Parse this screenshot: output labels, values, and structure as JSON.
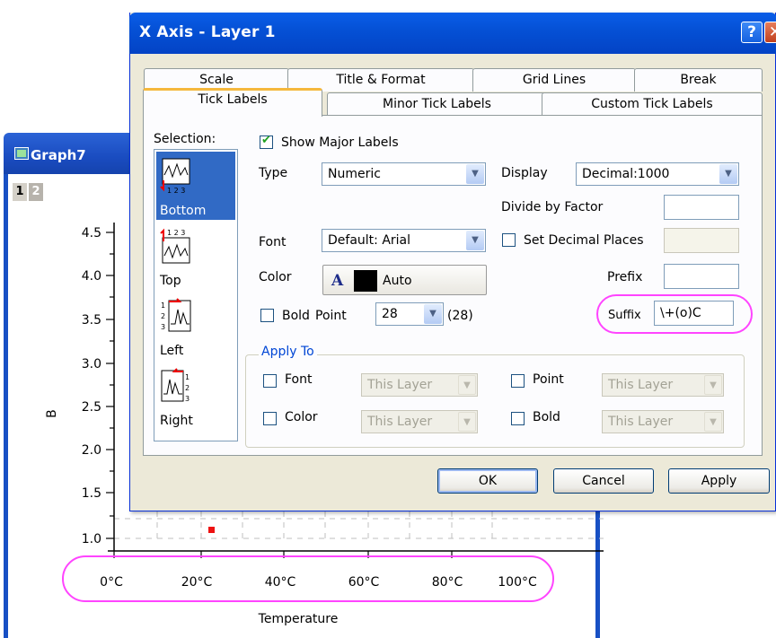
{
  "graph": {
    "title": "Graph7",
    "pages": [
      "1",
      "2"
    ],
    "y_axis_label": "B",
    "x_axis_label": "Temperature",
    "y_ticks": [
      "4.5",
      "4.0",
      "3.5",
      "3.0",
      "2.5",
      "2.0",
      "1.5",
      "1.0"
    ],
    "x_ticks": [
      "0°C",
      "20°C",
      "40°C",
      "60°C",
      "80°C",
      "100°C"
    ]
  },
  "dialog": {
    "title": "X Axis - Layer 1",
    "help_button": "?",
    "close_button": "✕",
    "tabs_back": [
      "Scale",
      "Title & Format",
      "Grid Lines",
      "Break"
    ],
    "tabs_front": [
      "Tick Labels",
      "Minor Tick Labels",
      "Custom Tick Labels"
    ],
    "selection_label": "Selection:",
    "selection_items": [
      "Bottom",
      "Top",
      "Left",
      "Right"
    ],
    "show_major_labels": "Show Major Labels",
    "type_label": "Type",
    "type_value": "Numeric",
    "display_label": "Display",
    "display_value": "Decimal:1000",
    "divide_by_factor_label": "Divide by Factor",
    "divide_by_factor_value": "",
    "font_label": "Font",
    "font_value": "Default: Arial",
    "set_decimal_places_label": "Set Decimal Places",
    "color_label": "Color",
    "color_glyph": "A",
    "color_value": "Auto",
    "prefix_label": "Prefix",
    "prefix_value": "",
    "bold_label": "Bold",
    "point_label": "Point",
    "point_value": "28",
    "point_actual": "(28)",
    "suffix_label": "Suffix",
    "suffix_value": "\\+(o)C",
    "apply_to_title": "Apply To",
    "apply_rows": [
      {
        "label": "Font",
        "value": "This Layer",
        "label2": "Point",
        "value2": "This Layer"
      },
      {
        "label": "Color",
        "value": "This Layer",
        "label2": "Bold",
        "value2": "This Layer"
      }
    ],
    "ok_label": "OK",
    "cancel_label": "Cancel",
    "apply_label": "Apply"
  },
  "colors": {
    "highlight": "#ff44ff",
    "titlebar": "#0a5ee8",
    "selection": "#316ac5"
  }
}
